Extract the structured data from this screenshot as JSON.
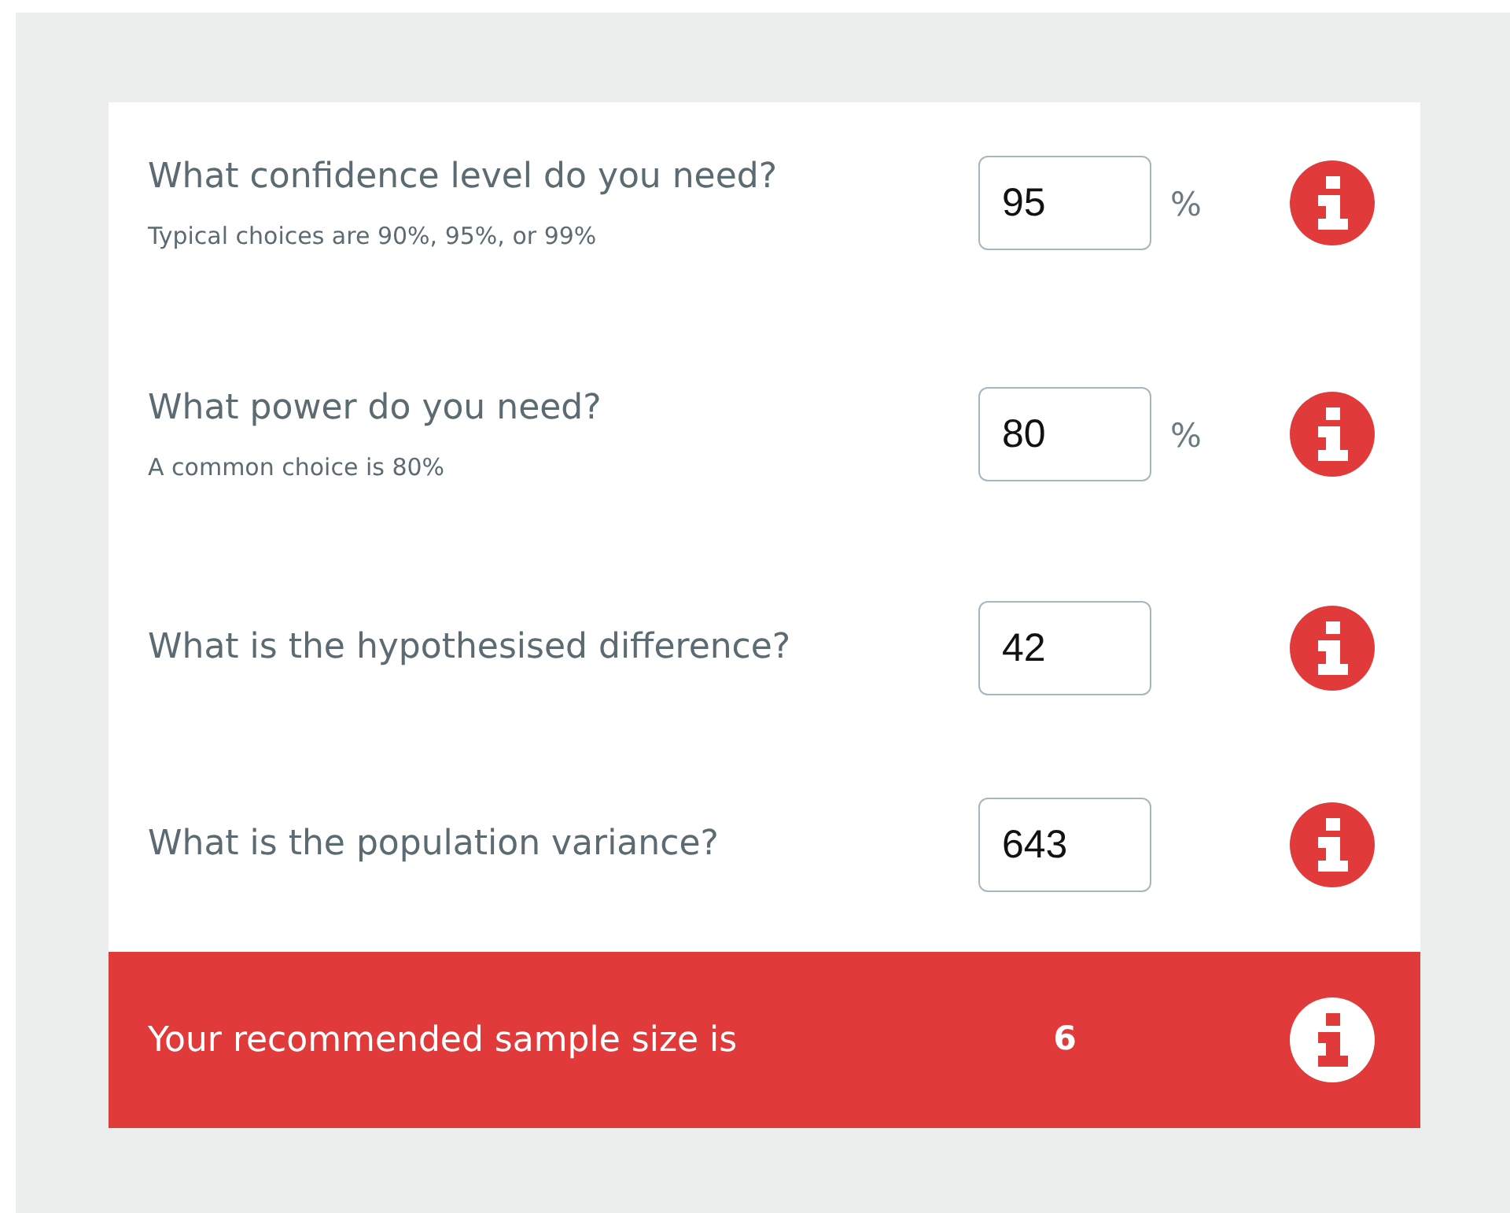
{
  "questions": [
    {
      "label": "What confidence level do you need?",
      "hint": "Typical choices are 90%, 95%, or 99%",
      "value": "95",
      "unit": "%"
    },
    {
      "label": "What power do you need?",
      "hint": "A common choice is 80%",
      "value": "80",
      "unit": "%"
    },
    {
      "label": "What is the hypothesised difference?",
      "value": "42"
    },
    {
      "label": "What is the population variance?",
      "value": "643"
    }
  ],
  "result": {
    "label": "Your recommended sample size is",
    "value": "6"
  }
}
